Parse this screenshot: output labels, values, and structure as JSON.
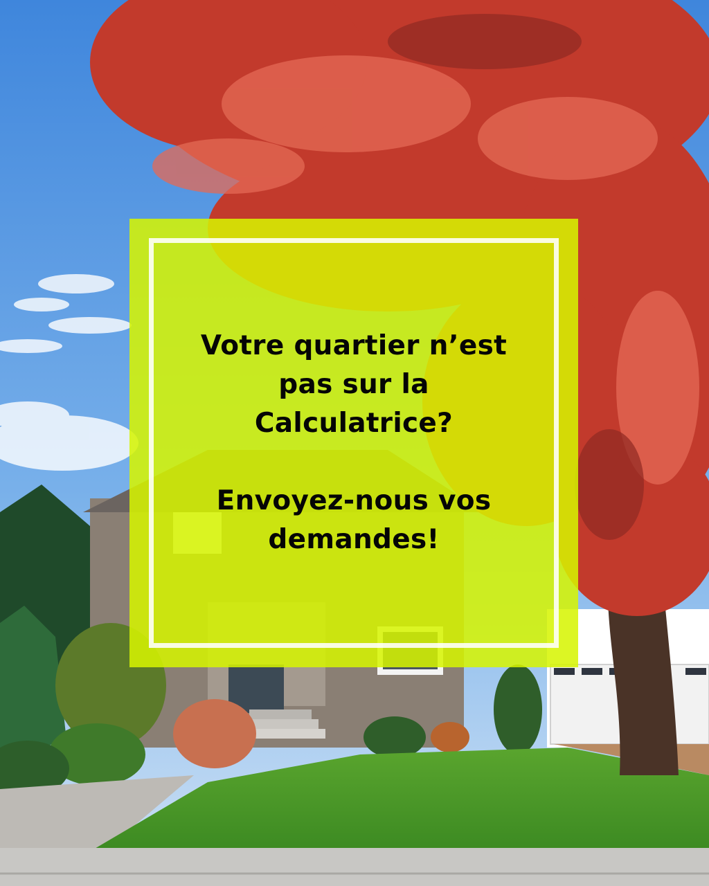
{
  "message": {
    "question_line1": "Votre quartier n’est",
    "question_line2": "pas sur la",
    "question_line3": "Calculatrice?",
    "cta_line1": "Envoyez-nous vos",
    "cta_line2": "demandes!"
  },
  "colors": {
    "card_overlay": "#d6f400",
    "frame": "#ffffff",
    "text": "#050505",
    "sky": "#5a9be0",
    "foliage": "#c23a2c",
    "lawn": "#4f9a2a"
  },
  "icons": [
    "maple-tree-illustration",
    "house-illustration"
  ]
}
